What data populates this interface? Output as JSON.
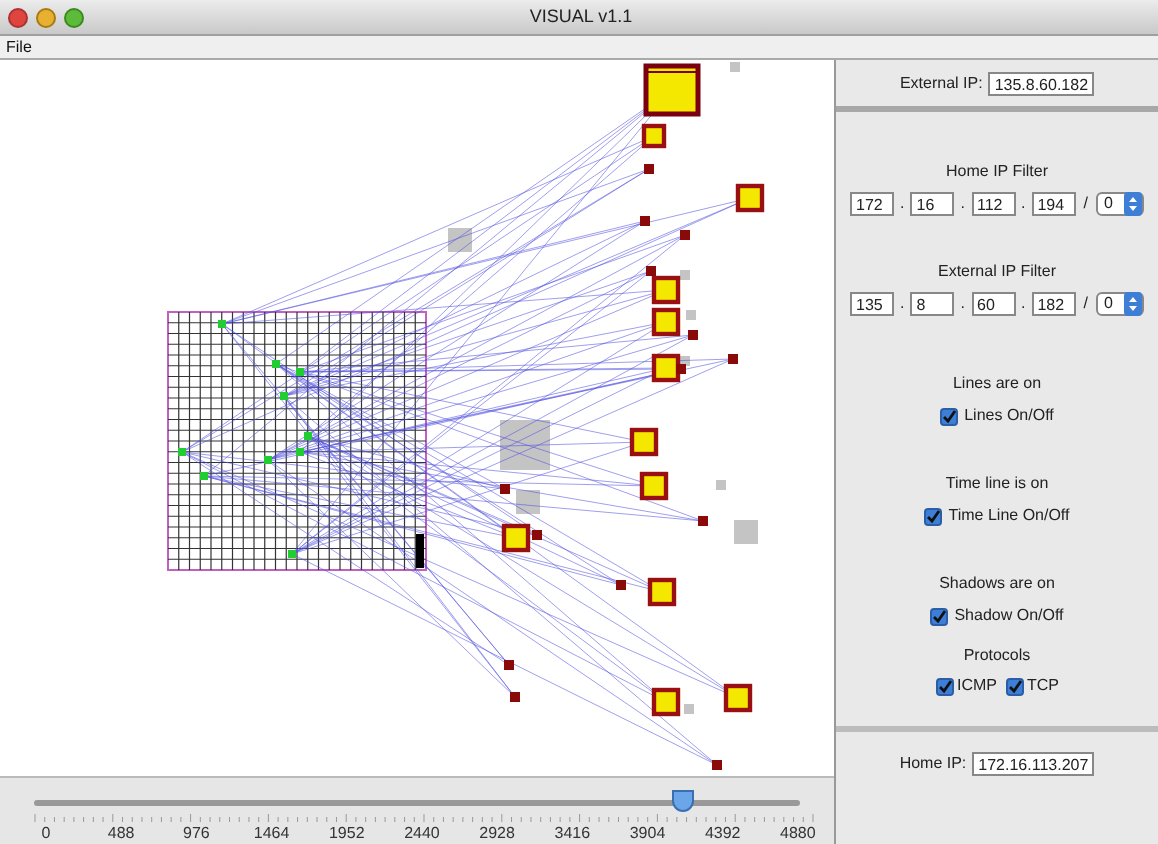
{
  "window": {
    "title": "VISUAL v1.1"
  },
  "menu": [
    "File"
  ],
  "timeline": {
    "level": 0.845,
    "ticks": [
      "0",
      "488",
      "976",
      "1464",
      "1952",
      "2440",
      "2928",
      "3416",
      "3904",
      "4392",
      "4880"
    ]
  },
  "panel": {
    "external_ip": {
      "label": "External IP:",
      "value": "135.8.60.182"
    },
    "filters": [
      {
        "title": "Home IP Filter",
        "octets": [
          "172",
          "16",
          "112",
          "194"
        ],
        "dot": ".",
        "slash": "/",
        "mask": "0"
      },
      {
        "title": "External IP Filter",
        "octets": [
          "135",
          "8",
          "60",
          "182"
        ],
        "dot": ".",
        "slash": "/",
        "mask": "0"
      }
    ],
    "toggles": [
      {
        "status": "Lines are on",
        "label": "Lines On/Off",
        "checked": true
      },
      {
        "status": "Time line is on",
        "label": "Time Line On/Off",
        "checked": true
      },
      {
        "status": "Shadows are on",
        "label": "Shadow On/Off",
        "checked": true
      }
    ],
    "protocols": {
      "title": "Protocols",
      "items": [
        {
          "label": "ICMP",
          "checked": true
        },
        {
          "label": "TCP",
          "checked": true
        }
      ]
    },
    "home_ip": {
      "label": "Home IP:",
      "value": "172.16.113.207"
    }
  }
}
